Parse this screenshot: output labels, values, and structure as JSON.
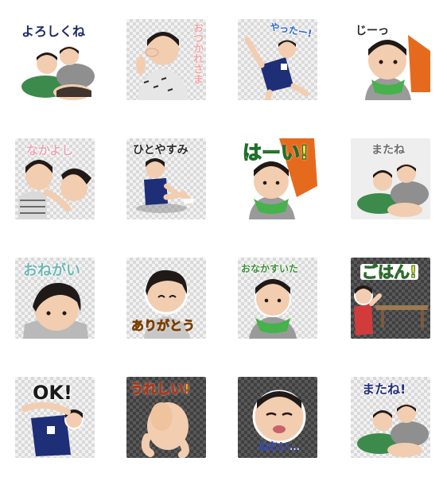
{
  "stickers": [
    {
      "caption": "よろしくね"
    },
    {
      "caption": "おつかれさま"
    },
    {
      "caption": "やったー!"
    },
    {
      "caption": "じーっ"
    },
    {
      "caption": "なかよし"
    },
    {
      "caption": "ひとやすみ"
    },
    {
      "caption": "はーい!"
    },
    {
      "caption": "またね"
    },
    {
      "caption": "おねがい"
    },
    {
      "caption": "ありがとう"
    },
    {
      "caption": "おなかすいた"
    },
    {
      "caption": "ごはん!"
    },
    {
      "caption": "OK!"
    },
    {
      "caption": "うれしい!"
    },
    {
      "caption": "ねむい…"
    },
    {
      "caption": "またね!"
    }
  ],
  "colors": {
    "skin": "#f3cdb0",
    "hair": "#1f1a18",
    "navy_shirt": "#1e2f78",
    "orange_cloth": "#e66a1e",
    "green_bib": "#45b24b",
    "gray_shirt": "#b9b9b9"
  }
}
